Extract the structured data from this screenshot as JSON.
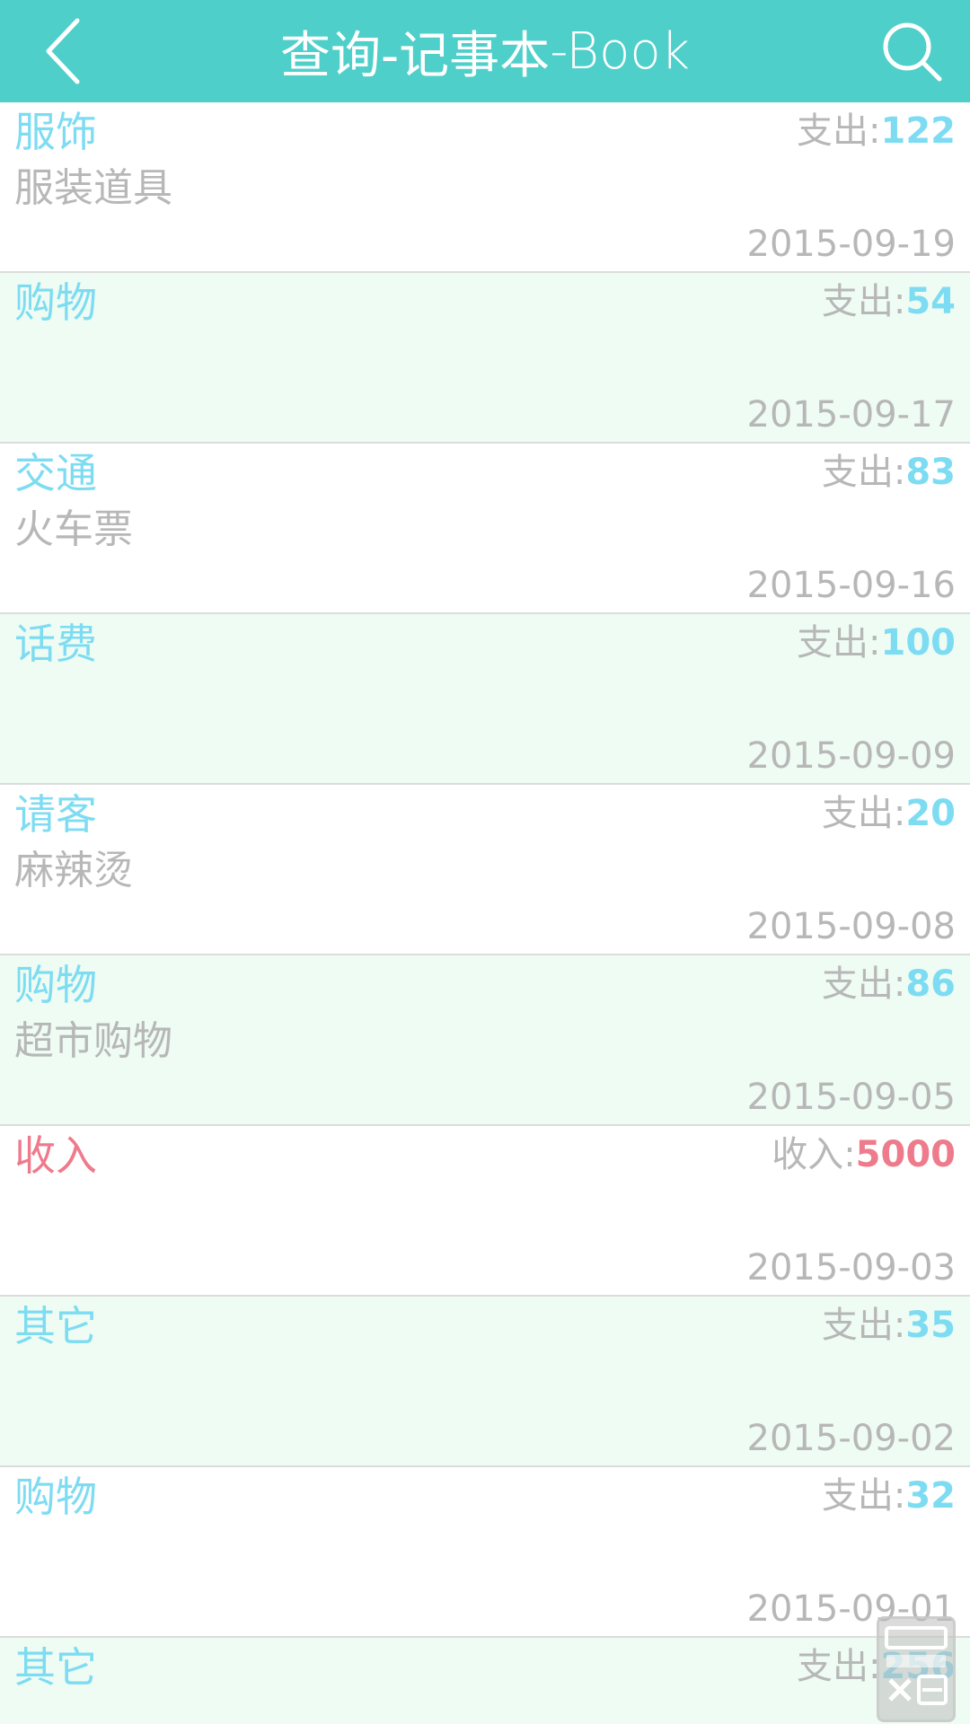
{
  "header": {
    "title_cn": "查询-记事本",
    "title_en": "-Book",
    "back_icon": "chevron-left-icon",
    "search_icon": "search-icon"
  },
  "colors": {
    "header_bg": "#4ecfc9",
    "expense_accent": "#7ddcf2",
    "income_accent": "#ee7b8c",
    "alt_row_bg": "#eefcf4",
    "muted_text": "#b7b7b7"
  },
  "records": [
    {
      "category": "服饰",
      "note": "服装道具",
      "type_label": "支出",
      "amount": "122",
      "date": "2015-09-19",
      "kind": "expense"
    },
    {
      "category": "购物",
      "note": "",
      "type_label": "支出",
      "amount": "54",
      "date": "2015-09-17",
      "kind": "expense"
    },
    {
      "category": "交通",
      "note": "火车票",
      "type_label": "支出",
      "amount": "83",
      "date": "2015-09-16",
      "kind": "expense"
    },
    {
      "category": "话费",
      "note": "",
      "type_label": "支出",
      "amount": "100",
      "date": "2015-09-09",
      "kind": "expense"
    },
    {
      "category": "请客",
      "note": "麻辣烫",
      "type_label": "支出",
      "amount": "20",
      "date": "2015-09-08",
      "kind": "expense"
    },
    {
      "category": "购物",
      "note": "超市购物",
      "type_label": "支出",
      "amount": "86",
      "date": "2015-09-05",
      "kind": "expense"
    },
    {
      "category": "收入",
      "note": "",
      "type_label": "收入",
      "amount": "5000",
      "date": "2015-09-03",
      "kind": "income"
    },
    {
      "category": "其它",
      "note": "",
      "type_label": "支出",
      "amount": "35",
      "date": "2015-09-02",
      "kind": "expense"
    },
    {
      "category": "购物",
      "note": "",
      "type_label": "支出",
      "amount": "32",
      "date": "2015-09-01",
      "kind": "expense"
    },
    {
      "category": "其它",
      "note": "",
      "type_label": "支出",
      "amount": "256",
      "date": "",
      "kind": "expense"
    }
  ],
  "floating_button": {
    "icon": "calculator-icon"
  }
}
